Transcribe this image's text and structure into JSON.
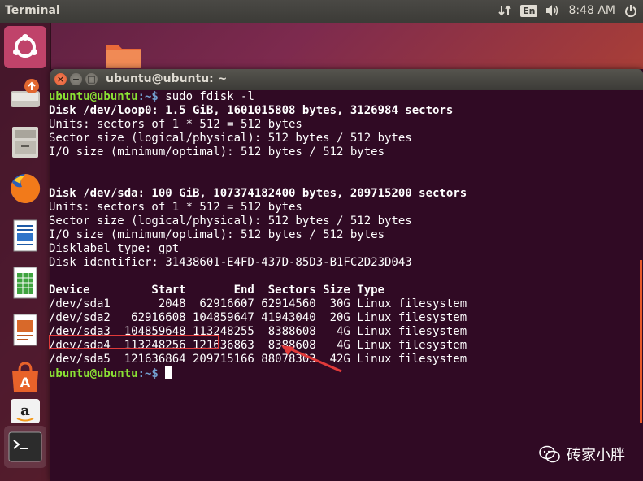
{
  "top_panel": {
    "app_title": "Terminal",
    "language": "En",
    "time": "8:48 AM",
    "icons": [
      "network-icon",
      "keyboard-language-icon",
      "volume-icon",
      "clock",
      "power-icon"
    ]
  },
  "launcher": {
    "items": [
      {
        "name": "ubuntu-dash-icon"
      },
      {
        "name": "software-updater-icon"
      },
      {
        "name": "files-cabinet-icon"
      },
      {
        "name": "firefox-icon"
      },
      {
        "name": "libreoffice-writer-icon"
      },
      {
        "name": "libreoffice-calc-icon"
      },
      {
        "name": "libreoffice-impress-icon"
      },
      {
        "name": "ubuntu-software-icon"
      },
      {
        "name": "amazon-icon"
      },
      {
        "name": "terminal-icon"
      }
    ]
  },
  "terminal": {
    "title": "ubuntu@ubuntu: ~",
    "prompt_user": "ubuntu@ubuntu",
    "prompt_path": ":~$",
    "command": " sudo fdisk -l",
    "lines": [
      {
        "text": "Disk /dev/loop0: 1.5 GiB, 1601015808 bytes, 3126984 sectors",
        "bold": true
      },
      {
        "text": "Units: sectors of 1 * 512 = 512 bytes",
        "bold": false
      },
      {
        "text": "Sector size (logical/physical): 512 bytes / 512 bytes",
        "bold": false
      },
      {
        "text": "I/O size (minimum/optimal): 512 bytes / 512 bytes",
        "bold": false
      },
      {
        "text": "",
        "bold": false
      },
      {
        "text": "",
        "bold": false
      },
      {
        "text": "Disk /dev/sda: 100 GiB, 107374182400 bytes, 209715200 sectors",
        "bold": true
      },
      {
        "text": "Units: sectors of 1 * 512 = 512 bytes",
        "bold": false
      },
      {
        "text": "Sector size (logical/physical): 512 bytes / 512 bytes",
        "bold": false
      },
      {
        "text": "I/O size (minimum/optimal): 512 bytes / 512 bytes",
        "bold": false
      },
      {
        "text": "Disklabel type: gpt",
        "bold": false
      },
      {
        "text": "Disk identifier: 31438601-E4FD-437D-85D3-B1FC2D23D043",
        "bold": false
      },
      {
        "text": "",
        "bold": false
      },
      {
        "text": "Device         Start       End  Sectors Size Type",
        "bold": true
      },
      {
        "text": "/dev/sda1       2048  62916607 62914560  30G Linux filesystem",
        "bold": false
      },
      {
        "text": "/dev/sda2   62916608 104859647 41943040  20G Linux filesystem",
        "bold": false
      },
      {
        "text": "/dev/sda3  104859648 113248255  8388608   4G Linux filesystem",
        "bold": false
      },
      {
        "text": "/dev/sda4  113248256 121636863  8388608   4G Linux filesystem",
        "bold": false
      },
      {
        "text": "/dev/sda5  121636864 209715166 88078303  42G Linux filesystem",
        "bold": false
      }
    ],
    "final_prompt_user": "ubuntu@ubuntu",
    "final_prompt_path": ":~$"
  },
  "watermark": {
    "text": "砖家小胖"
  },
  "colors": {
    "terminal_bg": "#300a24",
    "prompt_user": "#8ae234",
    "prompt_path": "#729fcf",
    "highlight": "#e03a3a"
  }
}
